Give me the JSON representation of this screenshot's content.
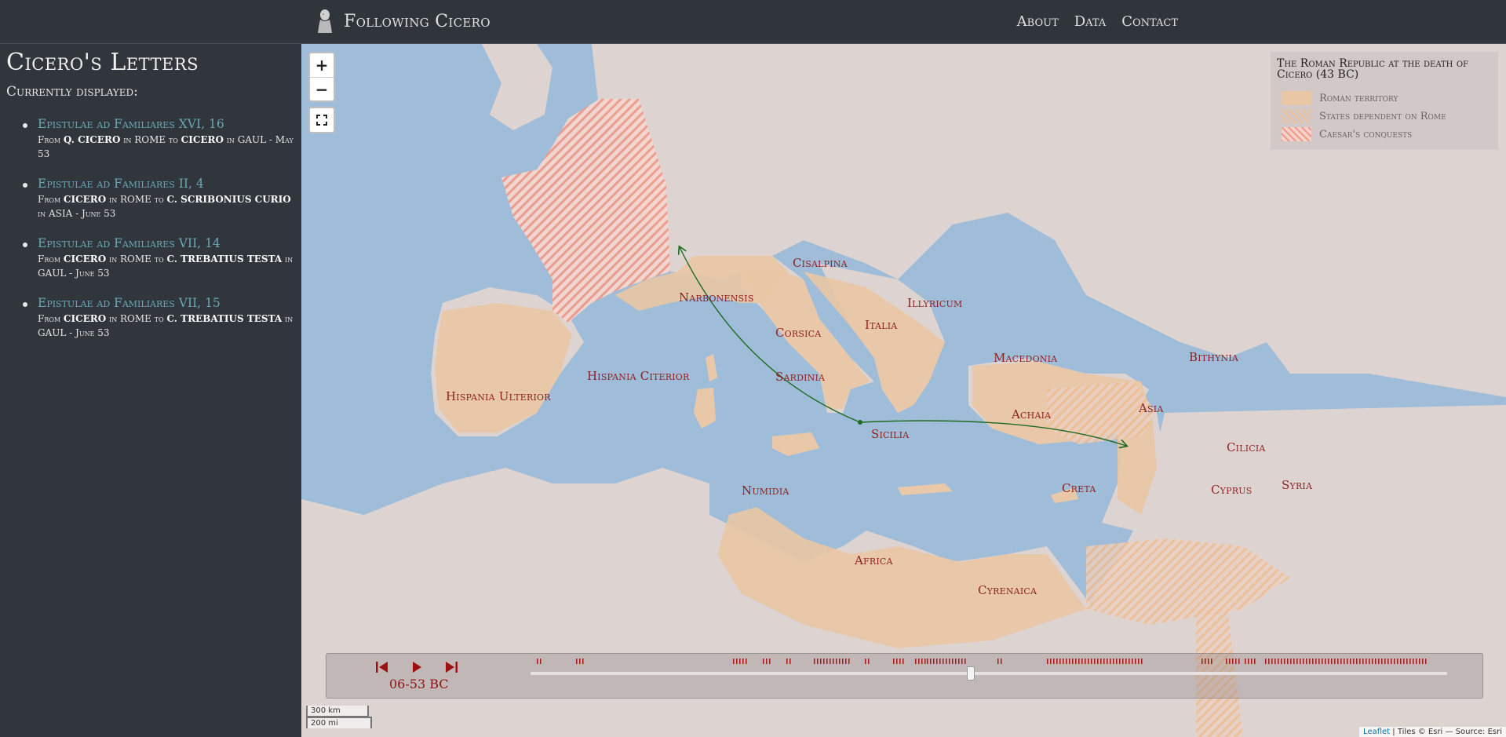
{
  "navbar": {
    "brand": "Following Cicero",
    "links": [
      "About",
      "Data",
      "Contact"
    ]
  },
  "sidebar": {
    "title": "Cicero's Letters",
    "subtitle": "Currently displayed:",
    "letters": [
      {
        "title": "Epistulae ad Familiares XVI, 16",
        "meta": [
          "From ",
          "Q. CICERO",
          " in ROME to ",
          "CICERO",
          " in GAUL - May 53"
        ]
      },
      {
        "title": "Epistulae ad Familiares II, 4",
        "meta": [
          "From ",
          "CICERO",
          " in ROME to ",
          "C. SCRIBONIUS CURIO",
          " in ASIA - June 53"
        ]
      },
      {
        "title": "Epistulae ad Familiares VII, 14",
        "meta": [
          "From ",
          "CICERO",
          " in ROME to ",
          "C. TREBATIUS TESTA",
          " in GAUL - June 53"
        ]
      },
      {
        "title": "Epistulae ad Familiares VII, 15",
        "meta": [
          "From ",
          "CICERO",
          " in ROME to ",
          "C. TREBATIUS TESTA",
          " in GAUL - June 53"
        ]
      }
    ]
  },
  "map": {
    "zoom_in": "+",
    "zoom_out": "−",
    "legend": {
      "title": "The Roman Republic at the death of Cicero (43 BC)",
      "items": [
        "Roman territory",
        "States dependent on Rome",
        "Caesar's conquests"
      ]
    },
    "regions": [
      "Cisalpina",
      "Narbonensis",
      "Illyricum",
      "Italia",
      "Corsica",
      "Macedonia",
      "Bithynia",
      "Hispania Citerior",
      "Sardinia",
      "Hispania Ulterior",
      "Asia",
      "Achaia",
      "Sicilia",
      "Cilicia",
      "Numidia",
      "Creta",
      "Cyprus",
      "Syria",
      "Africa",
      "Cyrenaica"
    ],
    "scale": {
      "km": "300 km",
      "mi": "200 mi"
    },
    "attribution": {
      "link": "Leaflet",
      "text": " | Tiles © Esri — Source: Esri"
    },
    "colors": {
      "sea": "#9fbcd8",
      "land": "#ddd4d2",
      "roman": "#e9c6a4",
      "caesar": "#f29a8a",
      "label": "#8e1f1f",
      "route": "#1e6b22"
    }
  },
  "timeline": {
    "current_date": "06-53 BC",
    "value_fraction": 0.48
  }
}
